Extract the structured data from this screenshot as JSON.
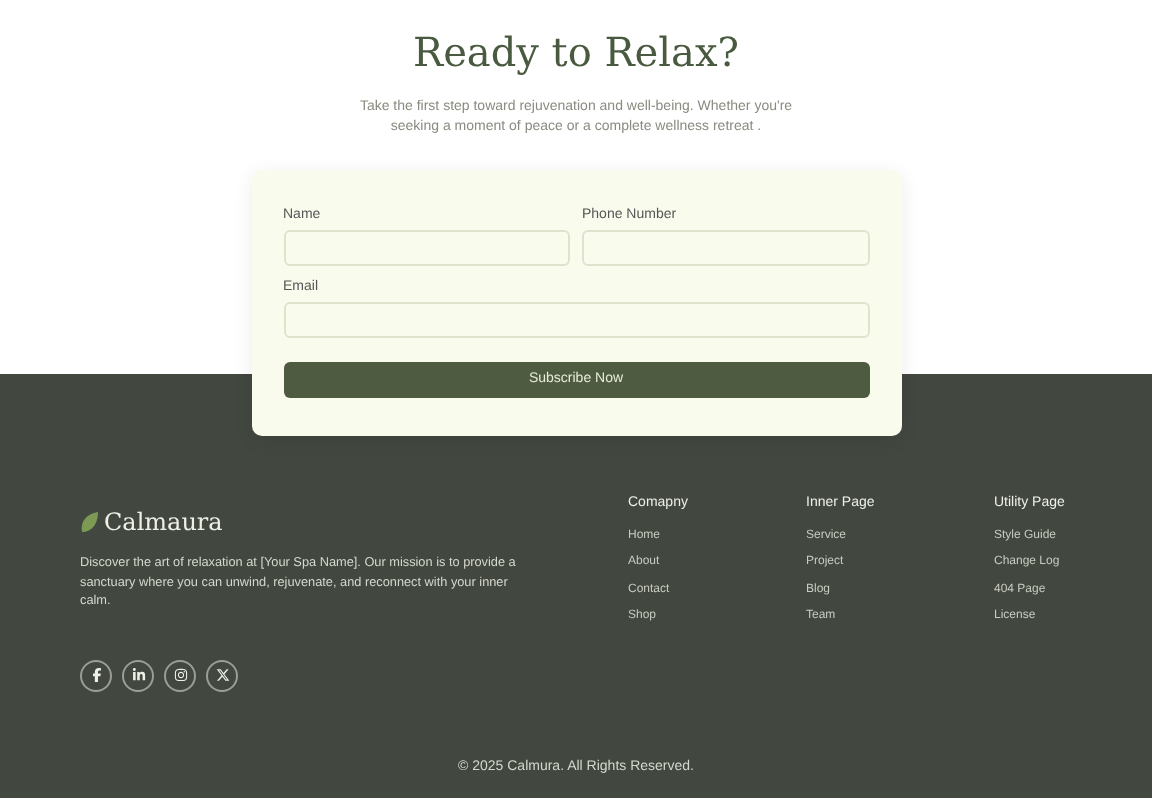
{
  "hero": {
    "title": "Ready to Relax?",
    "subtitle": "Take the first step toward rejuvenation and well-being. Whether you're seeking a moment of peace or a complete wellness retreat ."
  },
  "form": {
    "fields": [
      {
        "label": "Name",
        "kind": "half"
      },
      {
        "label": "Phone Number",
        "kind": "half"
      },
      {
        "label": "Email",
        "kind": "full"
      }
    ],
    "button": "Subscribe Now"
  },
  "footer": {
    "brand": "Calmaura",
    "description": "Discover the art of relaxation at [Your Spa Name]. Our mission is to provide a sanctuary where you can unwind, rejuvenate, and reconnect with your inner calm.",
    "socials": [
      {
        "kind": "facebook"
      },
      {
        "kind": "linkedin"
      },
      {
        "kind": "instagram"
      },
      {
        "kind": "x"
      }
    ],
    "columns": [
      {
        "title": "Comapny",
        "links": [
          "Home",
          "About",
          "Contact",
          "Shop"
        ]
      },
      {
        "title": "Inner Page",
        "links": [
          "Service",
          "Project",
          "Blog",
          "Team"
        ]
      },
      {
        "title": "Utility Page",
        "links": [
          "Style Guide",
          "Change Log",
          "404 Page",
          "License"
        ]
      }
    ],
    "copyright": "© 2025 Calmura. All Rights Reserved."
  }
}
